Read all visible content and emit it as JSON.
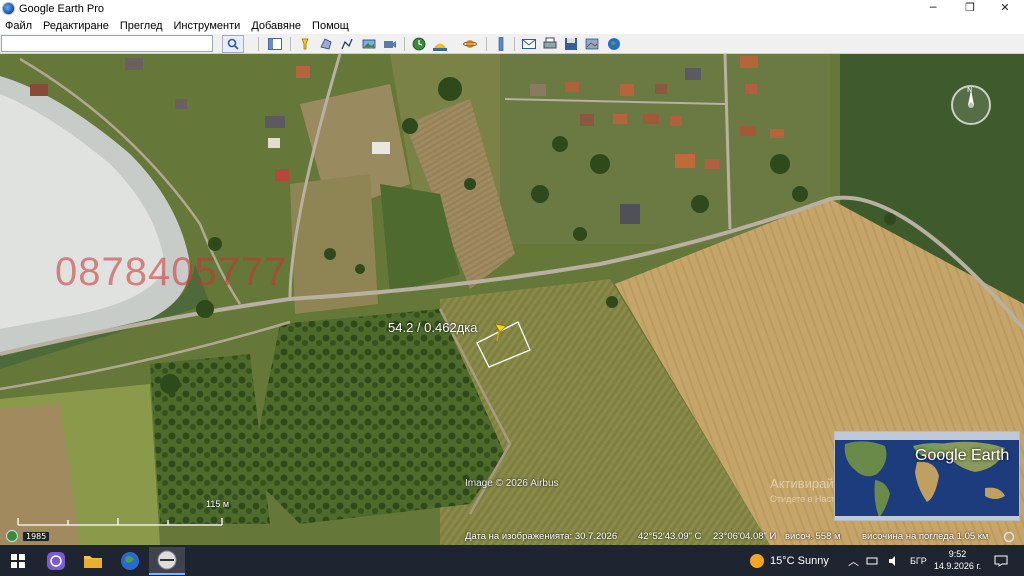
{
  "window": {
    "title": "Google Earth Pro",
    "controls": {
      "minimize": "─",
      "maximize": "❐",
      "close": "✕"
    }
  },
  "menu": {
    "items": [
      {
        "label": "Файл"
      },
      {
        "label": "Редактиране"
      },
      {
        "label": "Преглед"
      },
      {
        "label": "Инструменти"
      },
      {
        "label": "Добавяне"
      },
      {
        "label": "Помощ"
      }
    ]
  },
  "toolbar": {
    "search_value": "",
    "icons": [
      "sidebar-icon",
      "placemark-icon",
      "polygon-icon",
      "path-icon",
      "image-overlay-icon",
      "record-tour-icon",
      "historical-imagery-icon",
      "sunlight-icon",
      "planets-icon",
      "ruler-icon",
      "email-icon",
      "print-icon",
      "save-image-icon",
      "view-in-maps-icon",
      "earth-view-icon"
    ]
  },
  "map": {
    "watermark": "0878405777",
    "parcel_label": "54.2 / 0.462дка",
    "image_credit": "Image © 2026 Airbus",
    "scale_label": "115 м",
    "activate_line1": "Активирайте Windows",
    "activate_line2": "Отидете в Настройките, за да активирате",
    "logo": "Google Earth",
    "compass_north": "N"
  },
  "status": {
    "year": "1985",
    "imagery_date": "Дата на изображенията: 30.7.2026",
    "latitude": "42°52'43.09\" С",
    "longitude": "23°06'04.08\" И",
    "elevation": "височ.    558 м",
    "eye_altitude": "височина на погледа    1.05 км"
  },
  "taskbar": {
    "apps": [
      "windows-start",
      "viber",
      "file-explorer",
      "google-earth",
      "google-earth-pro"
    ],
    "weather": "15°C  Sunny",
    "language": "БГР",
    "time": "9:52",
    "date": "14.9.2026 г."
  }
}
